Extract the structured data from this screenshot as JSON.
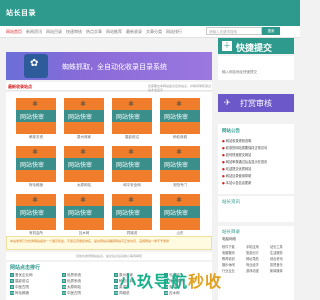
{
  "header": {
    "logo": "站长目录"
  },
  "nav": {
    "items": [
      "网站首页",
      "新闻资讯",
      "网站目录",
      "快速审核",
      "热点文章",
      "网站推荐",
      "最新收录",
      "文章分类",
      "网站排行"
    ],
    "search_placeholder": "请输入关键词搜索",
    "search_button": "搜索"
  },
  "banner": {
    "text": "蜘蛛抓取，全自动化收录目录系统"
  },
  "section": {
    "title": "最新收录站点",
    "right": "您需要在本网站提交您的站点，并等待审核通过后才会显示"
  },
  "cards": [
    {
      "label": "网站快审",
      "caption": "萌芽农资"
    },
    {
      "label": "网站快审",
      "caption": "泉州商家"
    },
    {
      "label": "网站快审",
      "caption": "摄影前沿"
    },
    {
      "label": "网站快审",
      "caption": "蚂蚁商城"
    },
    {
      "label": "网站快审",
      "caption": "阿毛鲜蔬"
    },
    {
      "label": "网站快审",
      "caption": "太原网站"
    },
    {
      "label": "网站快审",
      "caption": "和平安全网"
    },
    {
      "label": "网站快审",
      "caption": "安阳专门"
    },
    {
      "label": "网站快审",
      "caption": "有机会所"
    },
    {
      "label": "网站快审",
      "caption": "瓦木网"
    },
    {
      "label": "网站快审",
      "caption": "同城说"
    },
    {
      "label": "网站快审",
      "caption": "山东"
    }
  ],
  "notice": {
    "text": "本站收录只为优秀网站提供一个展示机会，不保证流量和排名，提交网站请确保网站可正常访问，违规网站一律不予收录"
  },
  "footnote": "目前共收录网站站点，提交站点后请耐心等待审核",
  "rank": {
    "title": "网站点击排行",
    "items": [
      "爱优企业网",
      "优质系统",
      "泉州商家",
      "长美网",
      "摄影前沿",
      "优质系统",
      "蚂蚁商城",
      "阿毛鲜蔬",
      "中医古院",
      "太原网站",
      "英诺思",
      "安阳市",
      "阿毛鲜蔬",
      "中医古院",
      "同城说",
      "瓦木网"
    ]
  },
  "sidebar": {
    "submit_label": "快捷提交",
    "submit_hint": "输入网站地址快速提交",
    "review_label": "打赏审核",
    "notice_title": "网站公告",
    "notice_items": [
      "网站收录规则说明",
      "收录的网站需要保持正常访问",
      "如何快速提交网站",
      "网站审核通过后会显示在首页",
      "欢迎提交优质网站",
      "网站目录使用帮助",
      "本站公告信息更新"
    ],
    "box3_title": "站长资讯",
    "box4_title": "站长目录",
    "box4_sub": "电脑网络",
    "box4_tags": [
      "软件下载",
      "手机应用",
      "站长工具",
      "电脑数码",
      "旅游出行",
      "生活服务",
      "教育培训",
      "网址导航",
      "综合资讯",
      "娱乐休闲",
      "商业经济",
      "影视音乐",
      "行业企业",
      "游戏动漫",
      "新闻媒体"
    ]
  },
  "watermark": {
    "part1": "小玖导航",
    "part2": "秒收"
  },
  "colors": {
    "brand": "#2e9a8d",
    "accent": "#d92020",
    "orange": "#f07d2c",
    "purple": "#6c58c9"
  }
}
